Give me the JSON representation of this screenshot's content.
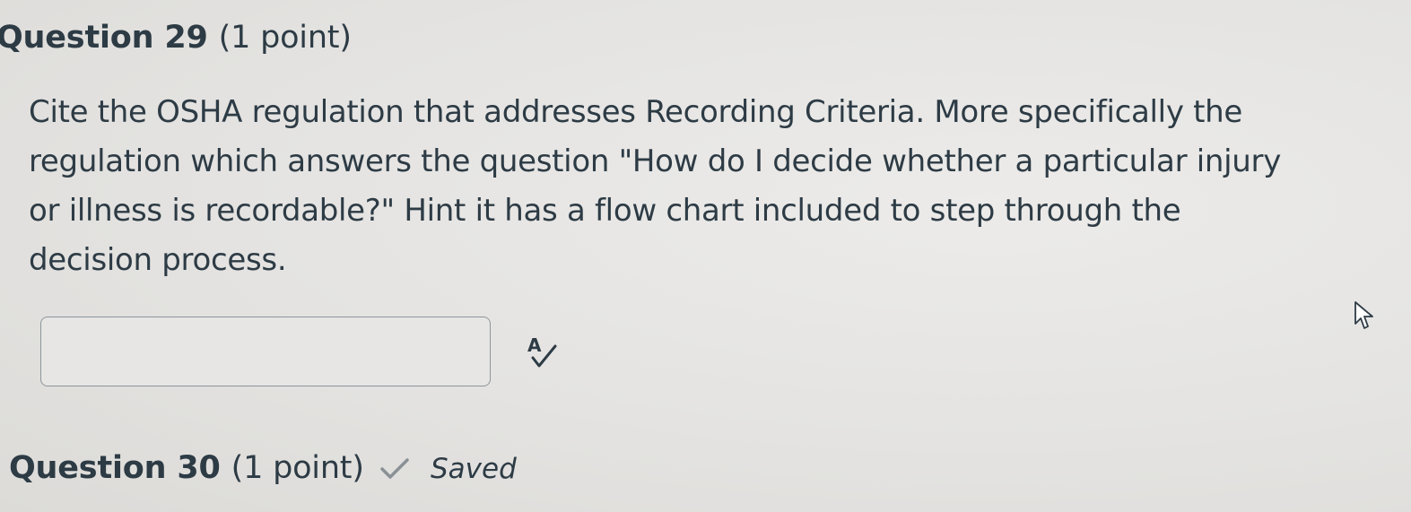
{
  "questions": [
    {
      "label": "Question 29",
      "points": "(1 point)",
      "prompt": "Cite the OSHA regulation that addresses Recording Criteria. More specifically the regulation which answers the question \"How do I decide whether a particular injury or illness is recordable?\" Hint it has a flow chart included to step through the decision process.",
      "answer_value": ""
    },
    {
      "label": "Question 30",
      "points": "(1 point)",
      "status": "Saved"
    }
  ],
  "icons": {
    "spell_check": "spell-check-icon",
    "saved_check": "checkmark-icon",
    "cursor": "mouse-pointer-icon"
  },
  "colors": {
    "text": "#2d3b45",
    "background": "#e6e5e3",
    "input_border": "#8d959b",
    "check": "#8a9196"
  }
}
